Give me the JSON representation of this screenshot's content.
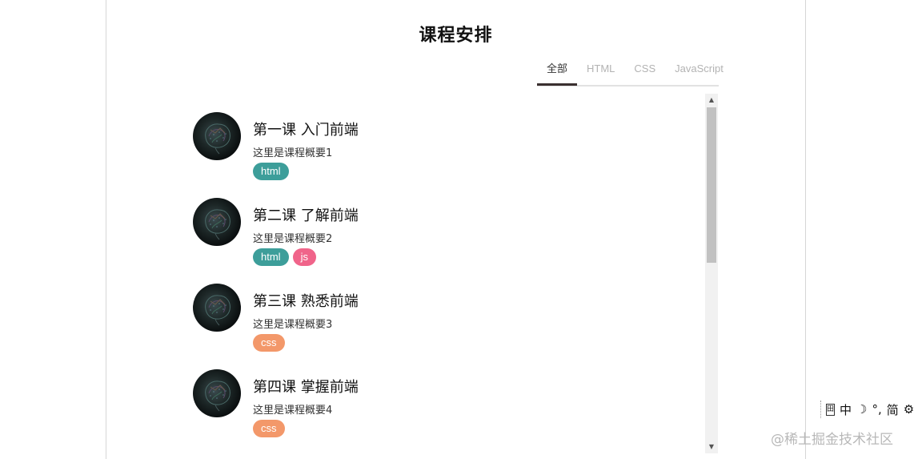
{
  "page_title": "课程安排",
  "tabs": [
    {
      "label": "全部",
      "active": true
    },
    {
      "label": "HTML",
      "active": false
    },
    {
      "label": "CSS",
      "active": false
    },
    {
      "label": "JavaScript",
      "active": false
    }
  ],
  "courses": [
    {
      "title": "第一课 入门前端",
      "desc": "这里是课程概要1",
      "tags": [
        {
          "label": "html",
          "color": "#3d9e9a"
        }
      ]
    },
    {
      "title": "第二课 了解前端",
      "desc": "这里是课程概要2",
      "tags": [
        {
          "label": "html",
          "color": "#3d9e9a"
        },
        {
          "label": "js",
          "color": "#f0648a"
        }
      ]
    },
    {
      "title": "第三课 熟悉前端",
      "desc": "这里是课程概要3",
      "tags": [
        {
          "label": "css",
          "color": "#f3986a"
        }
      ]
    },
    {
      "title": "第四课 掌握前端",
      "desc": "这里是课程概要4",
      "tags": [
        {
          "label": "css",
          "color": "#f3986a"
        }
      ]
    }
  ],
  "ime": {
    "grid_icon": "田",
    "lang": "中",
    "moon": "☽",
    "punct": "°,",
    "mode": "简",
    "gear": "⚙"
  },
  "watermark": "@稀土掘金技术社区"
}
